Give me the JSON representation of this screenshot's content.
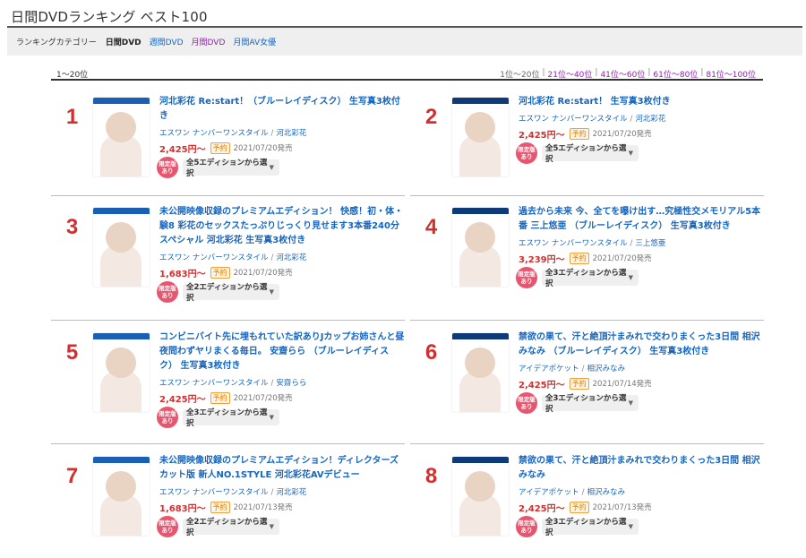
{
  "page": {
    "title": "日間DVDランキング ベスト100"
  },
  "category": {
    "label": "ランキングカテゴリー",
    "items": [
      {
        "label": "日間DVD",
        "active": true
      },
      {
        "label": "週間DVD"
      },
      {
        "label": "月間DVD"
      },
      {
        "label": "月間AV女優"
      }
    ]
  },
  "range": {
    "current": "1〜20位",
    "pages": [
      "1位〜20位",
      "21位〜40位",
      "41位〜60位",
      "61位〜80位",
      "81位〜100位"
    ]
  },
  "labels": {
    "preorder": "予約",
    "limited_line1": "限定版",
    "limited_line2": "あり"
  },
  "colors": {
    "accent_red": "#d32f2f",
    "link_blue": "#1565c0",
    "link_purple": "#8e24aa",
    "limited_pink": "#e8556e"
  },
  "items": [
    {
      "rank": "1",
      "title": "河北彩花 Re:start！（ブルーレイディスク） 生写真3枚付き",
      "maker": "エスワン ナンバーワンスタイル",
      "actress": "河北彩花",
      "price": "2,425円〜",
      "date": "2021/07/20発売",
      "editions": "全5エディションから選択"
    },
    {
      "rank": "2",
      "title": "河北彩花 Re:start！ 生写真3枚付き",
      "maker": "エスワン ナンバーワンスタイル",
      "actress": "河北彩花",
      "price": "2,425円〜",
      "date": "2021/07/20発売",
      "editions": "全5エディションから選択"
    },
    {
      "rank": "3",
      "title": "未公開映像収録のプレミアムエディション！ 快感！初・体・験8 彩花のセックスたっぷりじっくり見せます3本番240分スペシャル 河北彩花 生写真3枚付き",
      "maker": "エスワン ナンバーワンスタイル",
      "actress": "河北彩花",
      "price": "1,683円〜",
      "date": "2021/07/20発売",
      "editions": "全2エディションから選択"
    },
    {
      "rank": "4",
      "title": "過去から未来 今、全てを曝け出す…究極性交メモリアル5本番 三上悠亜 （ブルーレイディスク） 生写真3枚付き",
      "maker": "エスワン ナンバーワンスタイル",
      "actress": "三上悠亜",
      "price": "3,239円〜",
      "date": "2021/07/20発売",
      "editions": "全3エディションから選択"
    },
    {
      "rank": "5",
      "title": "コンビニバイト先に埋もれていた訳ありJカップお姉さんと昼夜問わずヤリまくる毎日。 安齋らら （ブルーレイディスク） 生写真3枚付き",
      "maker": "エスワン ナンバーワンスタイル",
      "actress": "安齋らら",
      "price": "2,425円〜",
      "date": "2021/07/20発売",
      "editions": "全3エディションから選択"
    },
    {
      "rank": "6",
      "title": "禁欲の果て、汗と絶頂汁まみれで交わりまくった3日間 相沢みなみ （ブルーレイディスク） 生写真3枚付き",
      "maker": "アイデアポケット",
      "actress": "相沢みなみ",
      "price": "2,425円〜",
      "date": "2021/07/14発売",
      "editions": "全3エディションから選択"
    },
    {
      "rank": "7",
      "title": "未公開映像収録のプレミアムエディション！ディレクターズカット版 新人NO.1STYLE 河北彩花AVデビュー",
      "maker": "エスワン ナンバーワンスタイル",
      "actress": "河北彩花",
      "price": "1,683円〜",
      "date": "2021/07/13発売",
      "editions": "全2エディションから選択"
    },
    {
      "rank": "8",
      "title": "禁欲の果て、汗と絶頂汁まみれで交わりまくった3日間 相沢みなみ",
      "maker": "アイデアポケット",
      "actress": "相沢みなみ",
      "price": "2,425円〜",
      "date": "2021/07/13発売",
      "editions": "全3エディションから選択"
    }
  ]
}
